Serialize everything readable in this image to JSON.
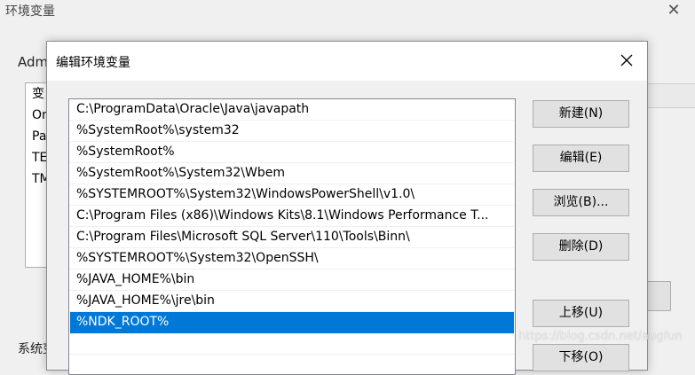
{
  "parent_window": {
    "title": "环境变量",
    "group_label": "Adm",
    "list_items": [
      "变",
      "On",
      "Pa",
      "TE",
      "TM"
    ],
    "bottom_label": "系统变"
  },
  "dialog": {
    "title": "编辑环境变量",
    "paths": [
      "C:\\ProgramData\\Oracle\\Java\\javapath",
      "%SystemRoot%\\system32",
      "%SystemRoot%",
      "%SystemRoot%\\System32\\Wbem",
      "%SYSTEMROOT%\\System32\\WindowsPowerShell\\v1.0\\",
      "C:\\Program Files (x86)\\Windows Kits\\8.1\\Windows Performance T...",
      "C:\\Program Files\\Microsoft SQL Server\\110\\Tools\\Binn\\",
      "%SYSTEMROOT%\\System32\\OpenSSH\\",
      "%JAVA_HOME%\\bin",
      "%JAVA_HOME%\\jre\\bin",
      "%NDK_ROOT%",
      ""
    ],
    "selected_index": 10,
    "buttons": {
      "new": "新建(N)",
      "edit": "编辑(E)",
      "browse": "浏览(B)...",
      "delete": "删除(D)",
      "move_up": "上移(U)",
      "move_down": "下移(O)"
    }
  },
  "watermark": "https://blog.csdn.net/augfun",
  "colors": {
    "selection": "#0078d7",
    "window_bg": "#f0f0f0"
  }
}
